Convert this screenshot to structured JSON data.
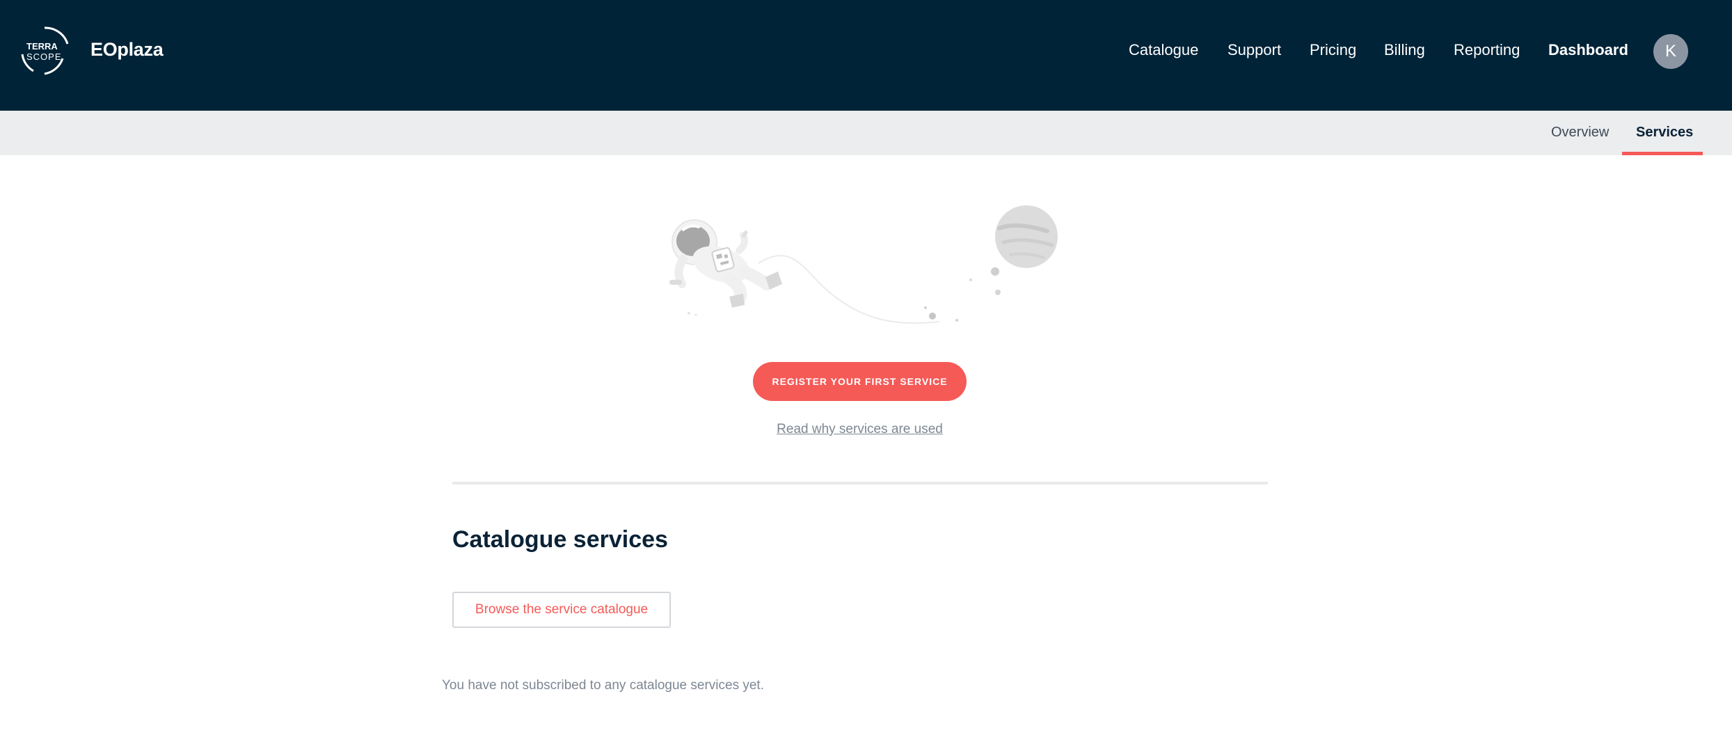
{
  "header": {
    "logo_line1": "TERRA",
    "logo_line2": "SCOPE",
    "brand": "EOplaza",
    "nav": {
      "catalogue": "Catalogue",
      "support": "Support",
      "pricing": "Pricing",
      "billing": "Billing",
      "reporting": "Reporting",
      "dashboard": "Dashboard"
    },
    "avatar_initial": "K"
  },
  "subnav": {
    "overview": "Overview",
    "services": "Services"
  },
  "empty_state": {
    "illustration": "astronaut-floating-illustration",
    "cta_label": "REGISTER YOUR FIRST SERVICE",
    "link_label": "Read why services are used"
  },
  "catalogue": {
    "title": "Catalogue services",
    "browse_label": "Browse the service catalogue",
    "empty_message": "You have not subscribed to any catalogue services yet."
  },
  "colors": {
    "header_bg": "#002337",
    "accent": "#f55a57",
    "subnav_bg": "#ebedef",
    "muted_text": "#7d8793"
  }
}
